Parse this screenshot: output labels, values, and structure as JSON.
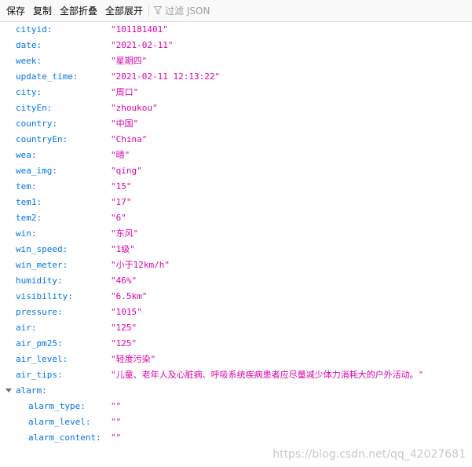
{
  "toolbar": {
    "save": "保存",
    "copy": "复制",
    "collapse_all": "全部折叠",
    "expand_all": "全部展开",
    "filter_placeholder": "过滤 JSON"
  },
  "rows": [
    {
      "key": "cityid:",
      "value": "\"101181401\""
    },
    {
      "key": "date:",
      "value": "\"2021-02-11\""
    },
    {
      "key": "week:",
      "value": "\"星期四\""
    },
    {
      "key": "update_time:",
      "value": "\"2021-02-11 12:13:22\""
    },
    {
      "key": "city:",
      "value": "\"周口\""
    },
    {
      "key": "cityEn:",
      "value": "\"zhoukou\""
    },
    {
      "key": "country:",
      "value": "\"中国\""
    },
    {
      "key": "countryEn:",
      "value": "\"China\""
    },
    {
      "key": "wea:",
      "value": "\"晴\""
    },
    {
      "key": "wea_img:",
      "value": "\"qing\""
    },
    {
      "key": "tem:",
      "value": "\"15\""
    },
    {
      "key": "tem1:",
      "value": "\"17\""
    },
    {
      "key": "tem2:",
      "value": "\"6\""
    },
    {
      "key": "win:",
      "value": "\"东风\""
    },
    {
      "key": "win_speed:",
      "value": "\"1级\""
    },
    {
      "key": "win_meter:",
      "value": "\"小于12km/h\""
    },
    {
      "key": "humidity:",
      "value": "\"46%\""
    },
    {
      "key": "visibility:",
      "value": "\"6.5km\""
    },
    {
      "key": "pressure:",
      "value": "\"1015\""
    },
    {
      "key": "air:",
      "value": "\"125\""
    },
    {
      "key": "air_pm25:",
      "value": "\"125\""
    },
    {
      "key": "air_level:",
      "value": "\"轻度污染\""
    },
    {
      "key": "air_tips:",
      "value": "\"儿童、老年人及心脏病、呼吸系统疾病患者应尽量减少体力消耗大的户外活动。\""
    }
  ],
  "alarm": {
    "key": "alarm:",
    "children": [
      {
        "key": "alarm_type:",
        "value": "\"\""
      },
      {
        "key": "alarm_level:",
        "value": "\"\""
      },
      {
        "key": "alarm_content:",
        "value": "\"\""
      }
    ]
  },
  "watermark": "https://blog.csdn.net/qq_42027681",
  "colors": {
    "key": "#0074e8",
    "string_value": "#dd00a9"
  },
  "icons": {
    "filter": "funnel-icon",
    "expand": "triangle-down-icon"
  }
}
